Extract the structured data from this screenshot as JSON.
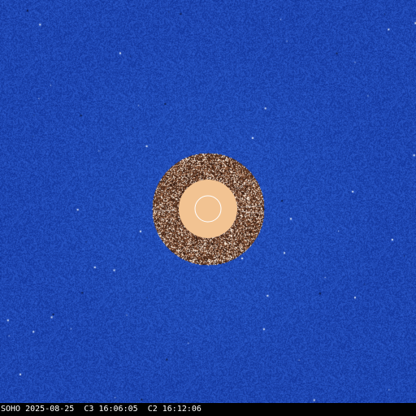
{
  "caption": {
    "observatory": "SOHO",
    "date": "2025-08-25",
    "c3_label": "C3",
    "c3_time": "16:06:05",
    "c2_label": "C2",
    "c2_time": "16:12:06"
  },
  "colors": {
    "sky_background": "#1f48b4",
    "inner_occulter": "#f2c392",
    "sun_circle": "#ffffff",
    "caption_bar": "#000000",
    "caption_text": "#ffffff"
  }
}
